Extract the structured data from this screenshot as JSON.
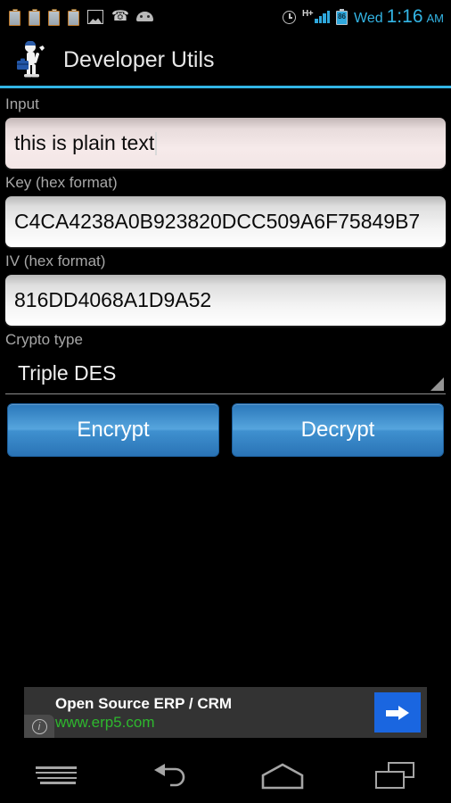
{
  "statusbar": {
    "left_icons": [
      "clipboard-icon",
      "clipboard-icon",
      "clipboard-icon",
      "clipboard-icon",
      "image-icon",
      "phone-call-icon",
      "android-bugdroid-icon"
    ],
    "right_icons": [
      "alarm-clock-icon",
      "signal-hplus-icon",
      "battery-icon"
    ],
    "network_type": "H+",
    "battery_percent": "86",
    "day": "Wed",
    "time": "1:16",
    "ampm": "AM"
  },
  "actionbar": {
    "app_icon": "developer-utils-icon",
    "title": "Developer Utils",
    "accent_color": "#33b5e5"
  },
  "form": {
    "input": {
      "label": "Input",
      "value": "this is plain text",
      "placeholder": "",
      "focused": true
    },
    "key": {
      "label": "Key (hex format)",
      "value": "C4CA4238A0B923820DCC509A6F75849B7",
      "placeholder": ""
    },
    "iv": {
      "label": "IV (hex format)",
      "value": "816DD4068A1D9A52",
      "placeholder": ""
    },
    "crypto_type": {
      "label": "Crypto type",
      "selected": "Triple DES"
    },
    "encrypt_label": "Encrypt",
    "decrypt_label": "Decrypt",
    "button_color": "#3f90cf"
  },
  "ad": {
    "title": "Open Source ERP / CRM",
    "url": "www.erp5.com",
    "url_color": "#2eb82e",
    "cta_icon": "arrow-right-icon",
    "cta_color": "#1a66e0",
    "adchoices_icon": "info-icon"
  },
  "navbar": {
    "menu": "menu-icon",
    "back": "back-icon",
    "home": "home-icon",
    "recent": "recent-apps-icon"
  }
}
